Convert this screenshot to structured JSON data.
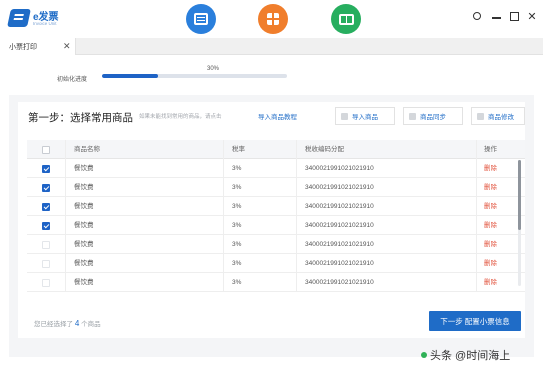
{
  "app": {
    "logo_text": "e发票",
    "logo_sub": "Invoice Unit",
    "icons": [
      "invoice-icon",
      "apps-grid-icon",
      "book-icon"
    ],
    "window_controls": [
      "gear-icon",
      "minimize-icon",
      "maximize-icon",
      "close-icon"
    ]
  },
  "tabs": [
    {
      "label": "小票打印",
      "close": "✕"
    }
  ],
  "progress": {
    "label": "初始化进度",
    "percent_text": "30%",
    "value": 0.3
  },
  "step": {
    "title": "第一步：选择常用商品",
    "hint": "如果未能找到常用的商品，请点击",
    "hint_link": "导入商品教程",
    "actions": {
      "import": "导入商品",
      "sync": "商品同步",
      "edit": "商品修改"
    }
  },
  "table": {
    "columns": [
      "商品名称",
      "税率",
      "税收编码分配",
      "操作"
    ],
    "rows": [
      {
        "checked": true,
        "name": "餐饮费",
        "rate": "3%",
        "code": "3400021991021021910",
        "op": "删除"
      },
      {
        "checked": true,
        "name": "餐饮费",
        "rate": "3%",
        "code": "3400021991021021910",
        "op": "删除"
      },
      {
        "checked": true,
        "name": "餐饮费",
        "rate": "3%",
        "code": "3400021991021021910",
        "op": "删除"
      },
      {
        "checked": true,
        "name": "餐饮费",
        "rate": "3%",
        "code": "3400021991021021910",
        "op": "删除"
      },
      {
        "checked": false,
        "name": "餐饮费",
        "rate": "3%",
        "code": "3400021991021021910",
        "op": "删除"
      },
      {
        "checked": false,
        "name": "餐饮费",
        "rate": "3%",
        "code": "3400021991021021910",
        "op": "删除"
      },
      {
        "checked": false,
        "name": "餐饮费",
        "rate": "3%",
        "code": "3400021991021021910",
        "op": "删除"
      }
    ]
  },
  "footer": {
    "selected_prefix": "您已经选择了",
    "selected_count": "4",
    "selected_suffix": "个商品",
    "next_button": "下一步 配置小票信息"
  },
  "watermark": "头条 @时间海上",
  "colors": {
    "accent": "#1f6cc7",
    "delete": "#e2533d",
    "icon_blue": "#2a7fdc",
    "icon_orange": "#f07e2c",
    "icon_green": "#27ae5f"
  }
}
